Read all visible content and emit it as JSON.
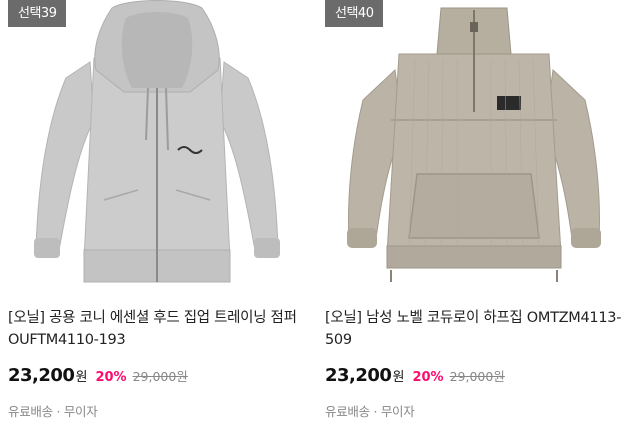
{
  "products": [
    {
      "badge": "선택39",
      "title": "[오닐] 공용 코니 에센셜 후드 집업 트레이닝 점퍼 OUFTM4110-193",
      "price": "23,200",
      "currency": "원",
      "discount": "20%",
      "original_price": "29,000원",
      "shipping": "유료배송 · 무이자",
      "image_color": "#c6c6c6"
    },
    {
      "badge": "선택40",
      "title": "[오닐] 남성 노벨 코듀로이 하프집 OMTZM4113-509",
      "price": "23,200",
      "currency": "원",
      "discount": "20%",
      "original_price": "29,000원",
      "shipping": "유료배송 · 무이자",
      "image_color": "#b9b2a4"
    }
  ],
  "colors": {
    "badge_bg": "#6b6b6b",
    "discount": "#ff0b6e",
    "text": "#222222",
    "muted": "#888888"
  }
}
